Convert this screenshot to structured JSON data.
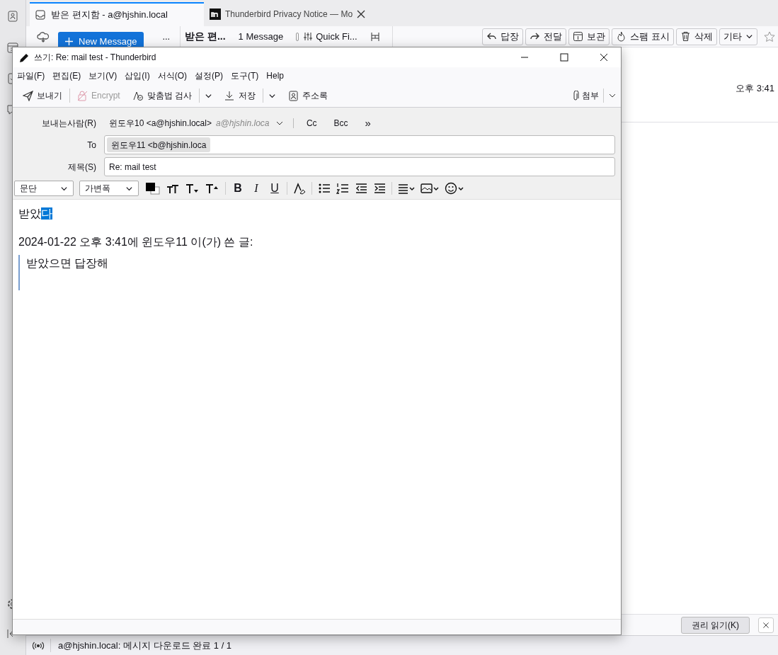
{
  "tabs": [
    {
      "label": "받은 편지함 - a@hjshin.local",
      "selected": true,
      "closable": false
    },
    {
      "label": "Thunderbird Privacy Notice — Mo",
      "selected": false,
      "closable": true
    }
  ],
  "mail_toolbar": {
    "new_message": "New Message",
    "more": "...",
    "folder_name": "받은 편...",
    "message_count": "1 Message",
    "quick_filter": "Quick Fi..."
  },
  "message_actions": [
    {
      "label": "답장"
    },
    {
      "label": "전달"
    },
    {
      "label": "보관"
    },
    {
      "label": "스팸 표시"
    },
    {
      "label": "삭제"
    },
    {
      "label": "기타",
      "dropdown": true
    }
  ],
  "message_list": {
    "time": "오후 3:41"
  },
  "notification": {
    "button": "권리 읽기(K)"
  },
  "status_bar": {
    "text": "a@hjshin.local: 메시지 다운로드 완료 1 / 1"
  },
  "compose": {
    "title": "쓰기: Re: mail test - Thunderbird",
    "menu": [
      "파일(F)",
      "편집(E)",
      "보기(V)",
      "삽입(I)",
      "서식(O)",
      "설정(P)",
      "도구(T)",
      "Help"
    ],
    "toolbar": [
      {
        "label": "보내기",
        "disabled": false,
        "dropdown": false
      },
      {
        "label": "Encrypt",
        "disabled": true,
        "dropdown": false
      },
      {
        "label": "맞춤법 검사",
        "disabled": false,
        "dropdown": true
      },
      {
        "label": "저장",
        "disabled": false,
        "dropdown": true
      },
      {
        "label": "주소록",
        "disabled": false,
        "dropdown": false
      }
    ],
    "attach": {
      "label": "첨부"
    },
    "from": {
      "label": "보내는사람(R)",
      "identity": "윈도우10 <a@hjshin.local>",
      "address": "a@hjshin.loca",
      "cc": "Cc",
      "bcc": "Bcc",
      "more": "»"
    },
    "to": {
      "label": "To",
      "recipients": [
        "윈도우11 <b@hjshin.loca"
      ]
    },
    "subject": {
      "label": "제목(S)",
      "value": "Re: mail test"
    },
    "format": {
      "paragraph": "문단",
      "font": "가변폭",
      "bold": "B",
      "italic": "I",
      "underline": "U"
    },
    "body": {
      "line": {
        "text": "받았",
        "selected_text": "다"
      },
      "attribution": "2024-01-22 오후 3:41에 윈도우11 이(가) 쓴 글:",
      "quote": "받았으면 답장해"
    }
  }
}
